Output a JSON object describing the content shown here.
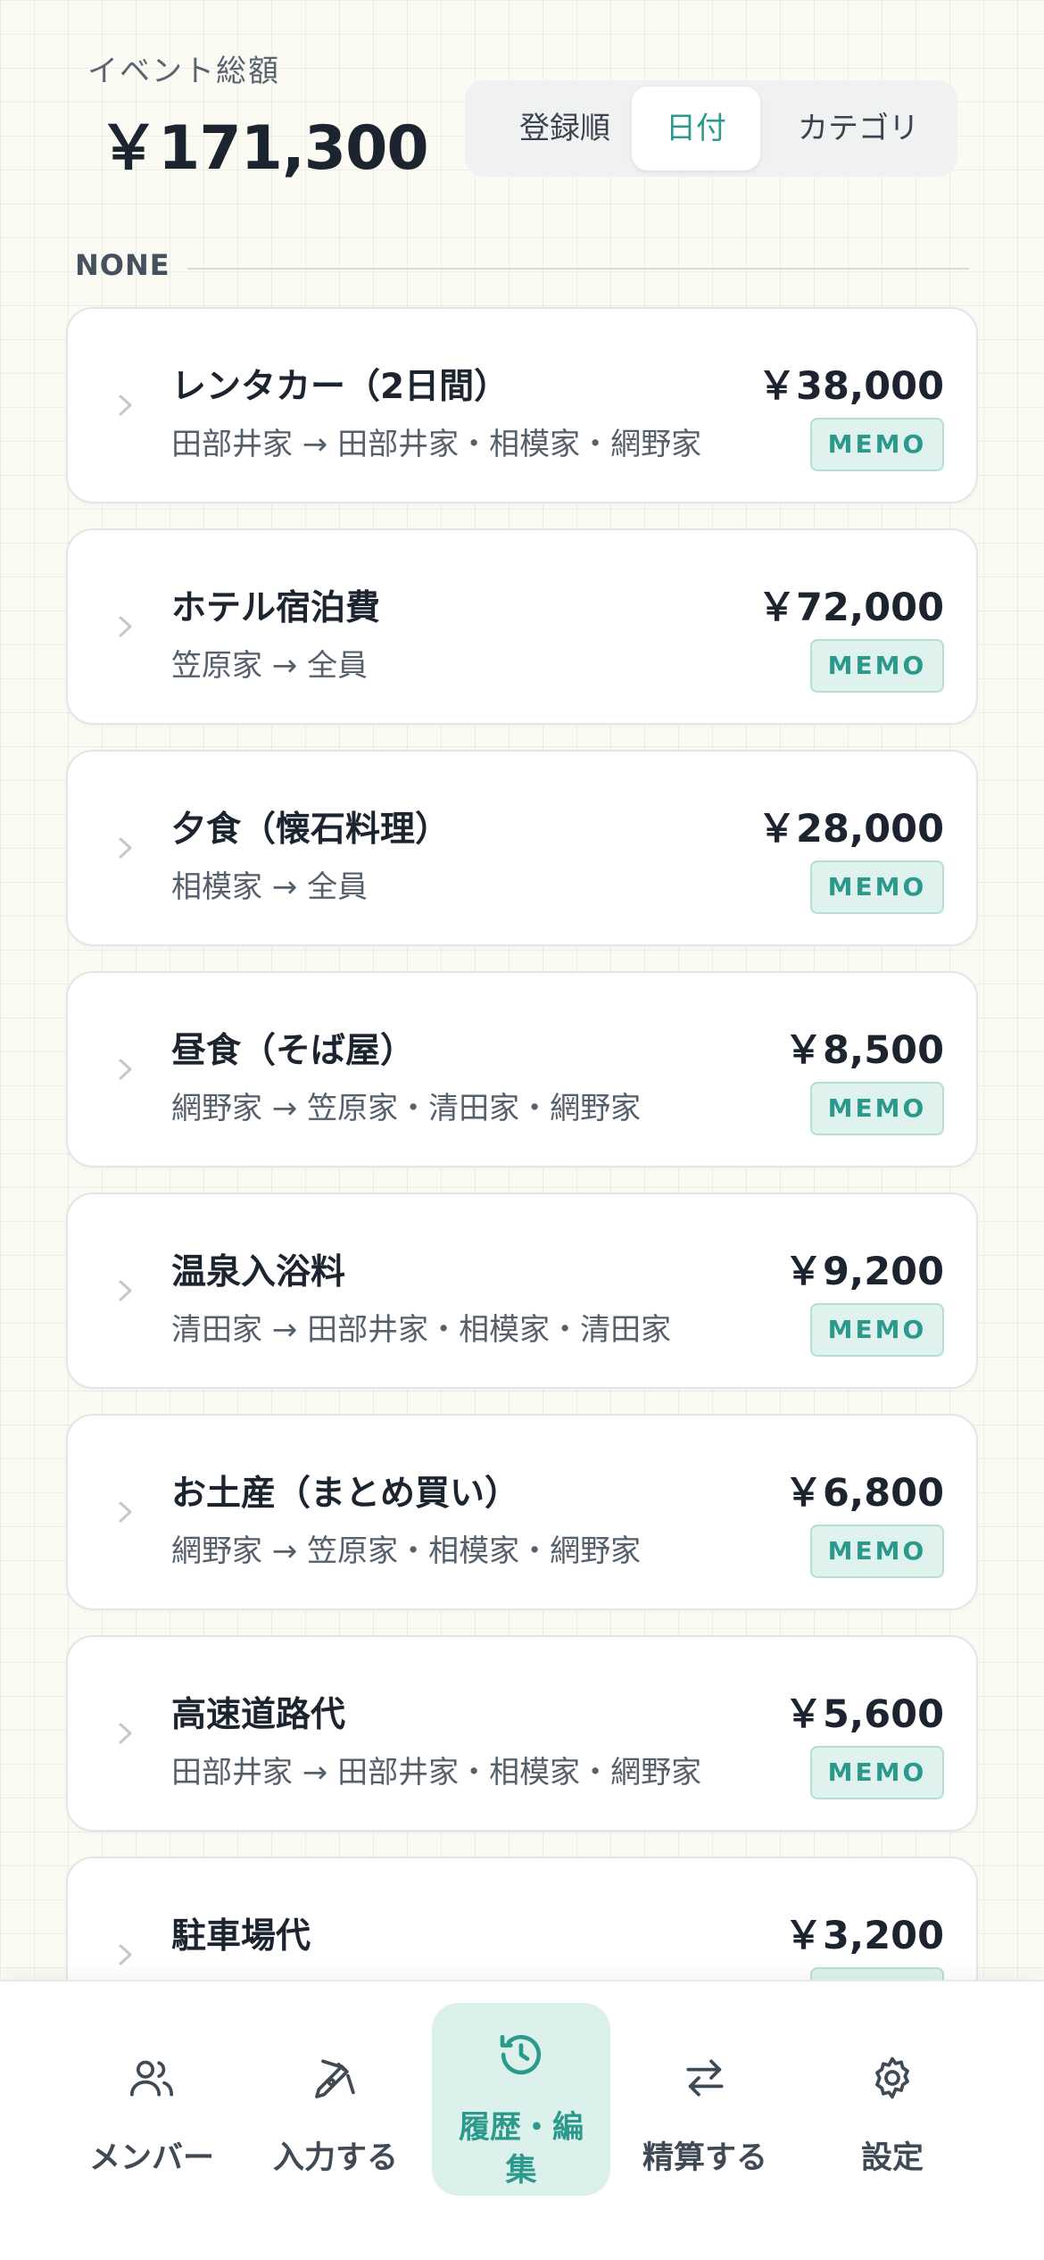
{
  "header": {
    "total_label": "イベント総額",
    "total_amount": "￥171,300"
  },
  "sort": {
    "options": [
      {
        "label": "登録順",
        "active": false
      },
      {
        "label": "日付",
        "active": true
      },
      {
        "label": "カテゴリ",
        "active": false
      }
    ]
  },
  "section": {
    "label": "NONE"
  },
  "memo_label": "MEMO",
  "items": [
    {
      "title": "レンタカー（2日間）",
      "sub": "田部井家 → 田部井家・相模家・網野家",
      "amount": "￥38,000"
    },
    {
      "title": "ホテル宿泊費",
      "sub": "笠原家 → 全員",
      "amount": "￥72,000"
    },
    {
      "title": "夕食（懐石料理）",
      "sub": "相模家 → 全員",
      "amount": "￥28,000"
    },
    {
      "title": "昼食（そば屋）",
      "sub": "網野家 → 笠原家・清田家・網野家",
      "amount": "￥8,500"
    },
    {
      "title": "温泉入浴料",
      "sub": "清田家 → 田部井家・相模家・清田家",
      "amount": "￥9,200"
    },
    {
      "title": "お土産（まとめ買い）",
      "sub": "網野家 → 笠原家・相模家・網野家",
      "amount": "￥6,800"
    },
    {
      "title": "高速道路代",
      "sub": "田部井家 → 田部井家・相模家・網野家",
      "amount": "￥5,600"
    },
    {
      "title": "駐車場代",
      "sub": "",
      "amount": "￥3,200"
    }
  ],
  "nav": {
    "items": [
      {
        "label": "メンバー",
        "icon": "users-icon"
      },
      {
        "label": "入力する",
        "icon": "pen-icon"
      },
      {
        "label": "履歴・編集",
        "icon": "history-icon",
        "active": true
      },
      {
        "label": "精算する",
        "icon": "swap-icon"
      },
      {
        "label": "設定",
        "icon": "gear-icon"
      }
    ]
  },
  "colors": {
    "accent": "#2b9a8c",
    "accent_bg": "#dcf1ec",
    "text": "#1c2430"
  }
}
